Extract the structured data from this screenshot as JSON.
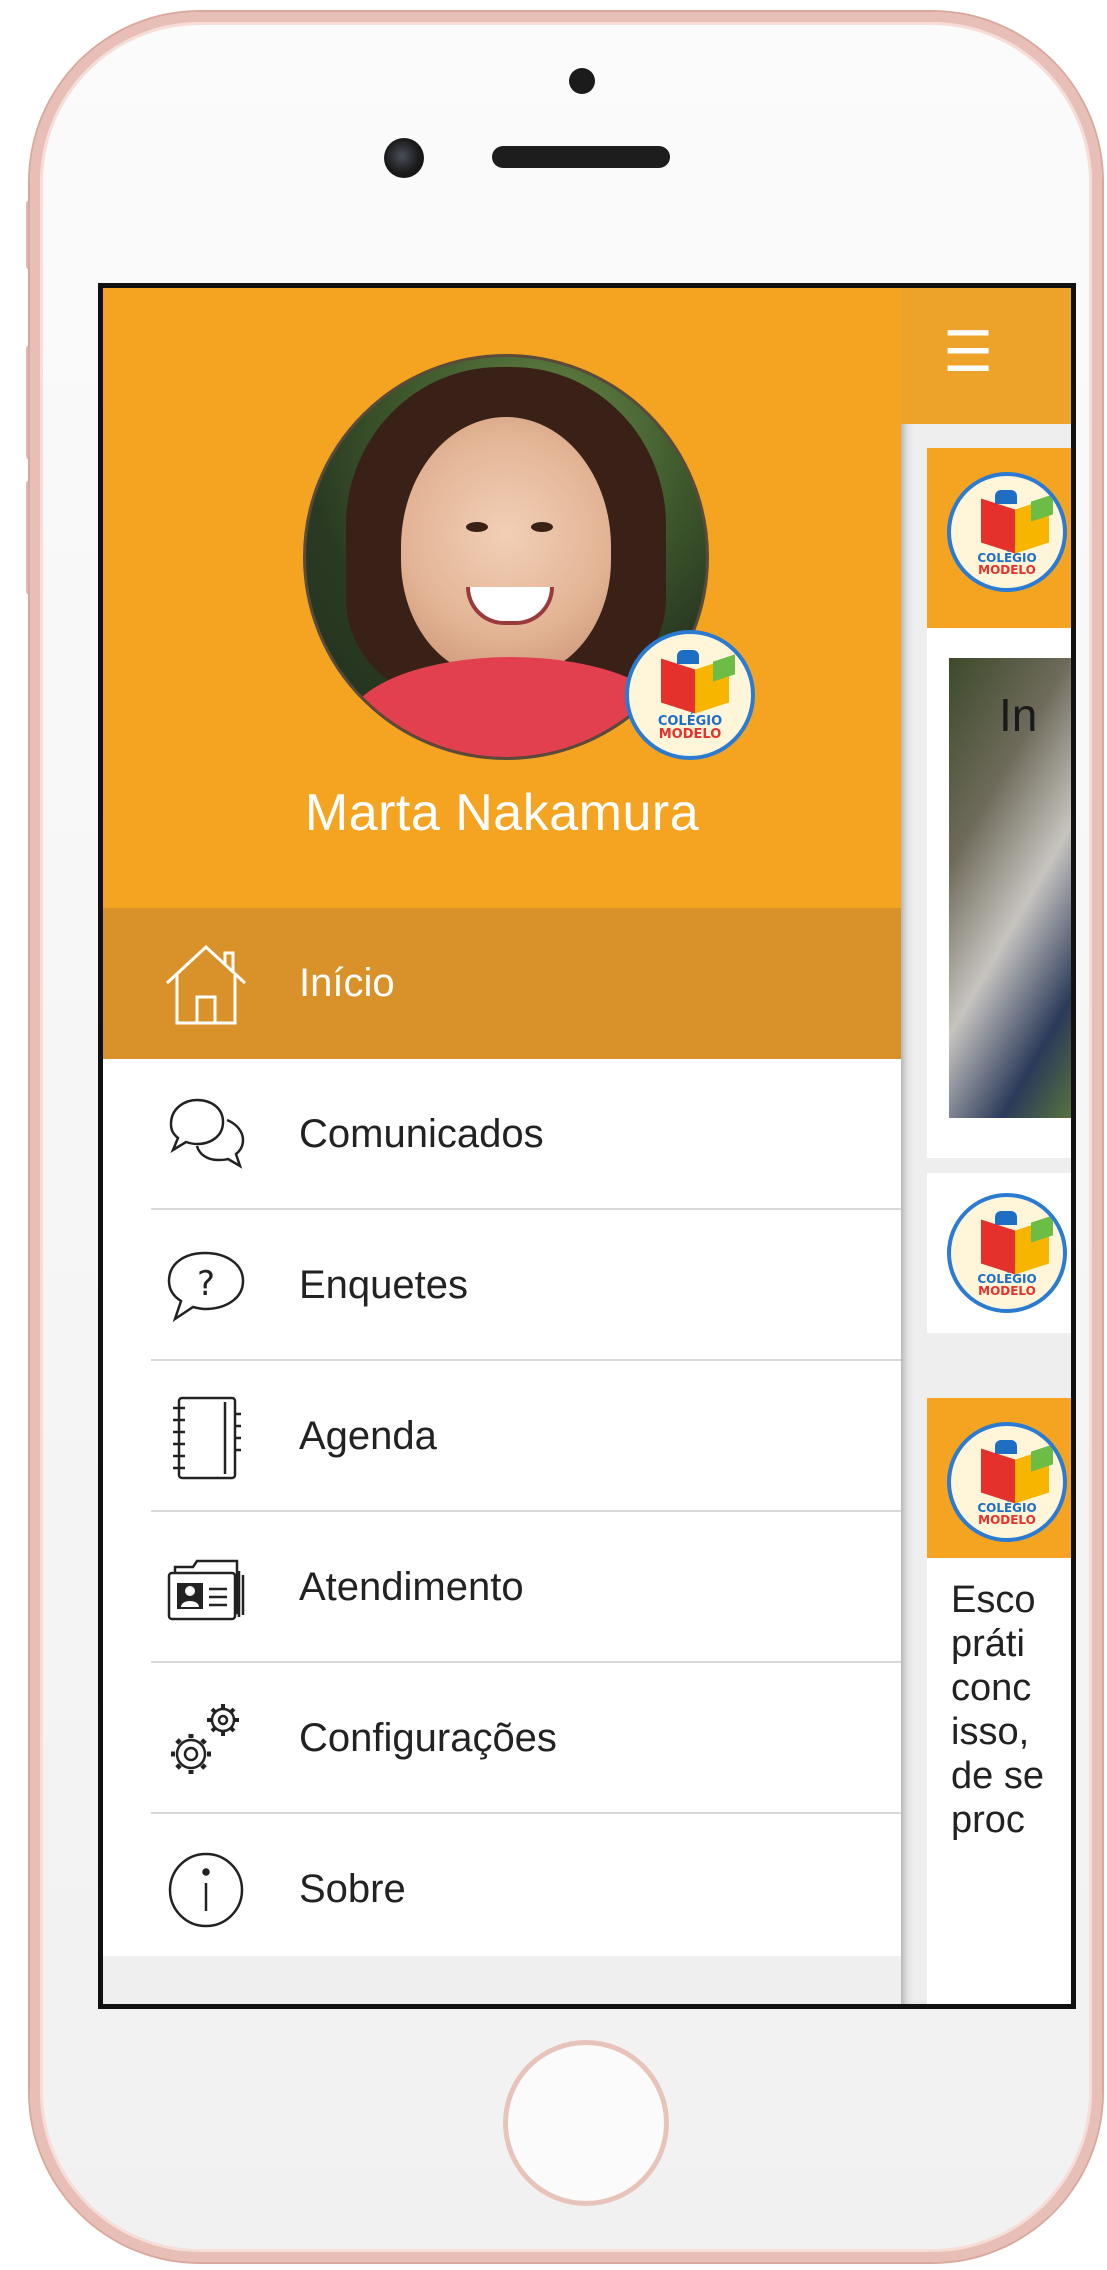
{
  "profile": {
    "name": "Marta Nakamura",
    "badge_line1": "COLÉGIO",
    "badge_line2": "MODELO"
  },
  "menu": {
    "items": [
      {
        "label": "Início",
        "icon": "home-icon",
        "active": true
      },
      {
        "label": "Comunicados",
        "icon": "chat-bubbles-icon"
      },
      {
        "label": "Enquetes",
        "icon": "question-bubble-icon"
      },
      {
        "label": "Agenda",
        "icon": "notebook-icon"
      },
      {
        "label": "Atendimento",
        "icon": "contact-card-icon"
      },
      {
        "label": "Configurações",
        "icon": "gears-icon"
      },
      {
        "label": "Sobre",
        "icon": "info-icon"
      }
    ]
  },
  "content": {
    "menu_glyph": "☰",
    "photo_caption": "In",
    "text_lines": [
      "Esco",
      "práti",
      "conc",
      "isso,",
      "de se",
      "proc"
    ]
  },
  "colors": {
    "accent": "#f4a420",
    "active_item": "#d9922a"
  }
}
